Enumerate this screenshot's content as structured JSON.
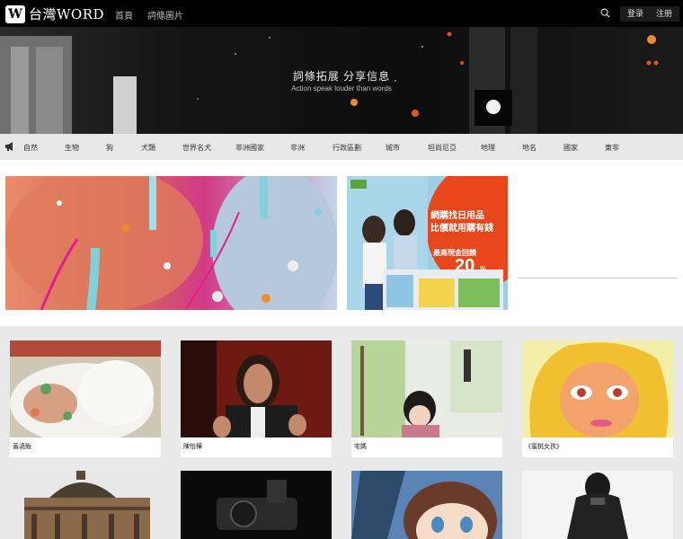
{
  "header": {
    "logo_mark": "W",
    "logo_text": "台灣WORD",
    "nav": [
      "首頁",
      "詞條圖片"
    ],
    "login_label": "登录",
    "register_label": "注册"
  },
  "hero": {
    "title": "詞條拓展 分享信息",
    "subtitle": "Action speak louder than words"
  },
  "categories": [
    "自然",
    "生物",
    "狗",
    "犬類",
    "世界名犬",
    "非洲國家",
    "非洲",
    "行政區劃",
    "城市",
    "坦尚尼亞",
    "地理",
    "地名",
    "國家",
    "東非"
  ],
  "ad": {
    "line1": "網購找日用品",
    "line2": "比價就用購有錢",
    "line3": "最高現金回饋",
    "percent": "20",
    "percent_sign": "%"
  },
  "cards": [
    {
      "label": "蓋澆飯"
    },
    {
      "label": "陳怡樺"
    },
    {
      "label": "宅媽"
    },
    {
      "label": "《蜜桃女孩》"
    },
    {
      "label": ""
    },
    {
      "label": ""
    },
    {
      "label": ""
    },
    {
      "label": ""
    }
  ],
  "colors": {
    "header_bg": "#000000",
    "category_bar": "#e7e7e7",
    "ad_accent": "#e8461b",
    "grid_bg": "#e9e9e9"
  }
}
